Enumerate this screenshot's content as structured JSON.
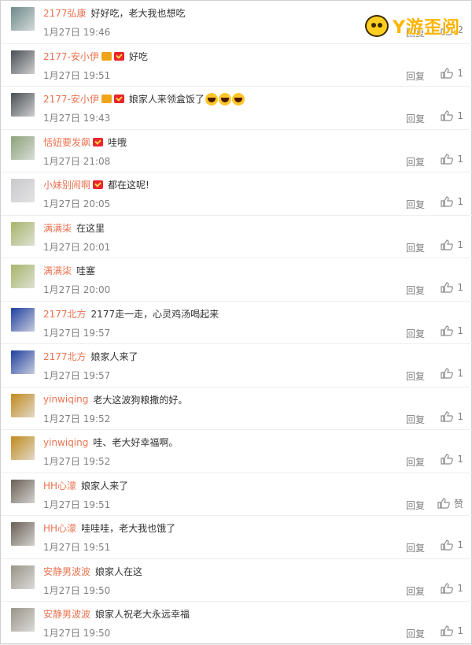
{
  "watermark": "Y游歪阅",
  "reply_label": "回复",
  "comments": [
    {
      "user": "2177弘康",
      "text": "好好吃，老大我也想吃",
      "time": "1月27日 19:46",
      "likes": "2",
      "badges": [],
      "emojis": 0,
      "avatar": "#6e8a8a"
    },
    {
      "user": "2177-安小伊",
      "text": "好吃",
      "time": "1月27日 19:51",
      "likes": "1",
      "badges": [
        "crown",
        "vip"
      ],
      "emojis": 0,
      "avatar": "#4a4f55"
    },
    {
      "user": "2177-安小伊",
      "text": "娘家人来领盒饭了",
      "time": "1月27日 19:43",
      "likes": "1",
      "badges": [
        "crown",
        "vip"
      ],
      "emojis": 3,
      "avatar": "#4a4f55"
    },
    {
      "user": "恬妞要发飙",
      "text": "哇哦",
      "time": "1月27日 21:08",
      "likes": "1",
      "badges": [
        "vip"
      ],
      "emojis": 0,
      "avatar": "#8ba27a"
    },
    {
      "user": "小妹别闹啊",
      "text": "都在这呢!",
      "time": "1月27日 20:05",
      "likes": "1",
      "badges": [
        "vip"
      ],
      "emojis": 0,
      "avatar": "#c9c9cc"
    },
    {
      "user": "满满柒",
      "text": "在这里",
      "time": "1月27日 20:01",
      "likes": "1",
      "badges": [],
      "emojis": 0,
      "avatar": "#a6b56a"
    },
    {
      "user": "满满柒",
      "text": "哇塞",
      "time": "1月27日 20:00",
      "likes": "1",
      "badges": [],
      "emojis": 0,
      "avatar": "#a6b56a"
    },
    {
      "user": "2177北方",
      "text": "2177走一走，心灵鸡汤喝起来",
      "time": "1月27日 19:57",
      "likes": "1",
      "badges": [],
      "emojis": 0,
      "avatar": "#1f3fa0"
    },
    {
      "user": "2177北方",
      "text": "娘家人来了",
      "time": "1月27日 19:57",
      "likes": "1",
      "badges": [],
      "emojis": 0,
      "avatar": "#1f3fa0"
    },
    {
      "user": "yinwiqing",
      "text": "老大这波狗粮撒的好。",
      "time": "1月27日 19:52",
      "likes": "1",
      "badges": [],
      "emojis": 0,
      "avatar": "#c08a1e"
    },
    {
      "user": "yinwiqing",
      "text": "哇、老大好幸福啊。",
      "time": "1月27日 19:52",
      "likes": "1",
      "badges": [],
      "emojis": 0,
      "avatar": "#c08a1e"
    },
    {
      "user": "HH心濛",
      "text": "娘家人来了",
      "time": "1月27日 19:51",
      "likes": "赞",
      "badges": [],
      "emojis": 0,
      "avatar": "#6a6055"
    },
    {
      "user": "HH心濛",
      "text": "哇哇哇，老大我也饿了",
      "time": "1月27日 19:51",
      "likes": "1",
      "badges": [],
      "emojis": 0,
      "avatar": "#6a6055"
    },
    {
      "user": "安静男波波",
      "text": "娘家人在这",
      "time": "1月27日 19:50",
      "likes": "1",
      "badges": [],
      "emojis": 0,
      "avatar": "#9a9488"
    },
    {
      "user": "安静男波波",
      "text": "娘家人祝老大永远幸福",
      "time": "1月27日 19:50",
      "likes": "1",
      "badges": [],
      "emojis": 0,
      "avatar": "#9a9488"
    }
  ]
}
